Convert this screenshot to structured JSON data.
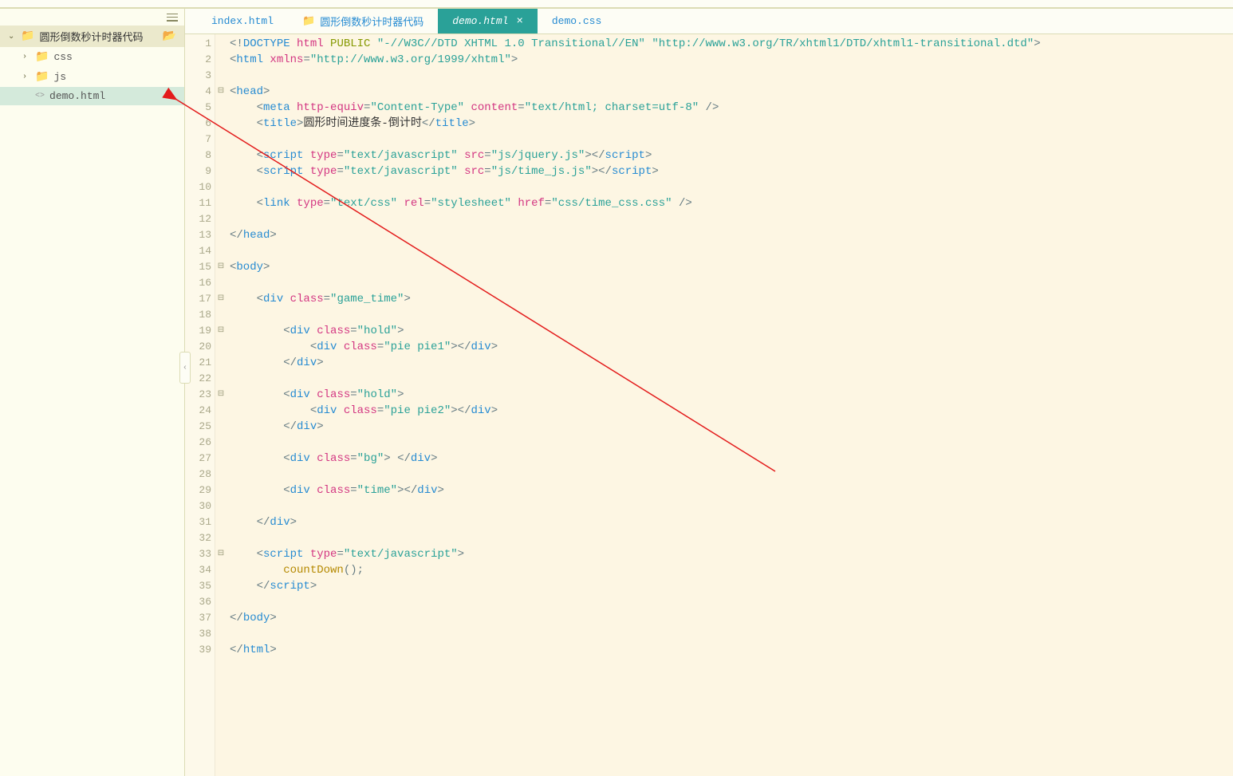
{
  "sidebar": {
    "root": {
      "label": "圆形倒数秒计时器代码"
    },
    "items": [
      {
        "label": "css",
        "type": "folder"
      },
      {
        "label": "js",
        "type": "folder"
      },
      {
        "label": "demo.html",
        "type": "file"
      }
    ]
  },
  "tabs": [
    {
      "label": "index.html",
      "active": false
    },
    {
      "label": "圆形倒数秒计时器代码",
      "active": false,
      "hasFolder": true
    },
    {
      "label": "demo.html",
      "active": true
    },
    {
      "label": "demo.css",
      "active": false
    }
  ],
  "code": {
    "lines": [
      {
        "n": 1,
        "fold": "",
        "segments": [
          {
            "c": "tok-punct",
            "t": "<!"
          },
          {
            "c": "tok-tag",
            "t": "DOCTYPE "
          },
          {
            "c": "tok-attr",
            "t": "html "
          },
          {
            "c": "tok-keyword",
            "t": "PUBLIC "
          },
          {
            "c": "tok-string",
            "t": "\"-//W3C//DTD XHTML 1.0 Transitional//EN\" \"http://www.w3.org/TR/xhtml1/DTD/xhtml1-transitional.dtd\""
          },
          {
            "c": "tok-punct",
            "t": ">"
          }
        ]
      },
      {
        "n": 2,
        "fold": "",
        "segments": [
          {
            "c": "tok-punct",
            "t": "<"
          },
          {
            "c": "tok-tag",
            "t": "html "
          },
          {
            "c": "tok-attr",
            "t": "xmlns"
          },
          {
            "c": "tok-punct",
            "t": "="
          },
          {
            "c": "tok-string",
            "t": "\"http://www.w3.org/1999/xhtml\""
          },
          {
            "c": "tok-punct",
            "t": ">"
          }
        ]
      },
      {
        "n": 3,
        "fold": "",
        "segments": []
      },
      {
        "n": 4,
        "fold": "⊟",
        "segments": [
          {
            "c": "tok-punct",
            "t": "<"
          },
          {
            "c": "tok-tag",
            "t": "head"
          },
          {
            "c": "tok-punct",
            "t": ">"
          }
        ]
      },
      {
        "n": 5,
        "fold": "",
        "indent": 1,
        "segments": [
          {
            "c": "tok-punct",
            "t": "    <"
          },
          {
            "c": "tok-tag",
            "t": "meta "
          },
          {
            "c": "tok-attr",
            "t": "http-equiv"
          },
          {
            "c": "tok-punct",
            "t": "="
          },
          {
            "c": "tok-string",
            "t": "\"Content-Type\" "
          },
          {
            "c": "tok-attr",
            "t": "content"
          },
          {
            "c": "tok-punct",
            "t": "="
          },
          {
            "c": "tok-string",
            "t": "\"text/html; charset=utf-8\" "
          },
          {
            "c": "tok-punct",
            "t": "/>"
          }
        ]
      },
      {
        "n": 6,
        "fold": "",
        "indent": 1,
        "segments": [
          {
            "c": "tok-punct",
            "t": "    <"
          },
          {
            "c": "tok-tag",
            "t": "title"
          },
          {
            "c": "tok-punct",
            "t": ">"
          },
          {
            "c": "tok-text",
            "t": "圆形时间进度条-倒计时"
          },
          {
            "c": "tok-punct",
            "t": "</"
          },
          {
            "c": "tok-tag",
            "t": "title"
          },
          {
            "c": "tok-punct",
            "t": ">"
          }
        ]
      },
      {
        "n": 7,
        "fold": "",
        "indent": 1,
        "segments": []
      },
      {
        "n": 8,
        "fold": "",
        "indent": 1,
        "segments": [
          {
            "c": "tok-punct",
            "t": "    <"
          },
          {
            "c": "tok-tag",
            "t": "script "
          },
          {
            "c": "tok-attr",
            "t": "type"
          },
          {
            "c": "tok-punct",
            "t": "="
          },
          {
            "c": "tok-string",
            "t": "\"text/javascript\" "
          },
          {
            "c": "tok-attr",
            "t": "src"
          },
          {
            "c": "tok-punct",
            "t": "="
          },
          {
            "c": "tok-string",
            "t": "\"js/jquery.js\""
          },
          {
            "c": "tok-punct",
            "t": "></"
          },
          {
            "c": "tok-tag",
            "t": "script"
          },
          {
            "c": "tok-punct",
            "t": ">"
          }
        ]
      },
      {
        "n": 9,
        "fold": "",
        "indent": 1,
        "segments": [
          {
            "c": "tok-punct",
            "t": "    <"
          },
          {
            "c": "tok-tag",
            "t": "script "
          },
          {
            "c": "tok-attr",
            "t": "type"
          },
          {
            "c": "tok-punct",
            "t": "="
          },
          {
            "c": "tok-string",
            "t": "\"text/javascript\" "
          },
          {
            "c": "tok-attr",
            "t": "src"
          },
          {
            "c": "tok-punct",
            "t": "="
          },
          {
            "c": "tok-string",
            "t": "\"js/time_js.js\""
          },
          {
            "c": "tok-punct",
            "t": "></"
          },
          {
            "c": "tok-tag",
            "t": "script"
          },
          {
            "c": "tok-punct",
            "t": ">"
          }
        ]
      },
      {
        "n": 10,
        "fold": "",
        "indent": 1,
        "segments": []
      },
      {
        "n": 11,
        "fold": "",
        "indent": 1,
        "segments": [
          {
            "c": "tok-punct",
            "t": "    <"
          },
          {
            "c": "tok-tag",
            "t": "link "
          },
          {
            "c": "tok-attr",
            "t": "type"
          },
          {
            "c": "tok-punct",
            "t": "="
          },
          {
            "c": "tok-string",
            "t": "\"text/css\" "
          },
          {
            "c": "tok-attr",
            "t": "rel"
          },
          {
            "c": "tok-punct",
            "t": "="
          },
          {
            "c": "tok-string",
            "t": "\"stylesheet\" "
          },
          {
            "c": "tok-attr",
            "t": "href"
          },
          {
            "c": "tok-punct",
            "t": "="
          },
          {
            "c": "tok-string",
            "t": "\"css/time_css.css\" "
          },
          {
            "c": "tok-punct",
            "t": "/>"
          }
        ]
      },
      {
        "n": 12,
        "fold": "",
        "indent": 1,
        "segments": []
      },
      {
        "n": 13,
        "fold": "",
        "segments": [
          {
            "c": "tok-punct",
            "t": "</"
          },
          {
            "c": "tok-tag",
            "t": "head"
          },
          {
            "c": "tok-punct",
            "t": ">"
          }
        ]
      },
      {
        "n": 14,
        "fold": "",
        "segments": []
      },
      {
        "n": 15,
        "fold": "⊟",
        "segments": [
          {
            "c": "tok-punct",
            "t": "<"
          },
          {
            "c": "tok-tag",
            "t": "body"
          },
          {
            "c": "tok-punct",
            "t": ">"
          }
        ]
      },
      {
        "n": 16,
        "fold": "",
        "indent": 1,
        "segments": []
      },
      {
        "n": 17,
        "fold": "⊟",
        "indent": 1,
        "segments": [
          {
            "c": "tok-punct",
            "t": "    <"
          },
          {
            "c": "tok-tag",
            "t": "div "
          },
          {
            "c": "tok-attr",
            "t": "class"
          },
          {
            "c": "tok-punct",
            "t": "="
          },
          {
            "c": "tok-string",
            "t": "\"game_time\""
          },
          {
            "c": "tok-punct",
            "t": ">"
          }
        ]
      },
      {
        "n": 18,
        "fold": "",
        "indent": 2,
        "segments": []
      },
      {
        "n": 19,
        "fold": "⊟",
        "indent": 2,
        "segments": [
          {
            "c": "tok-punct",
            "t": "        <"
          },
          {
            "c": "tok-tag",
            "t": "div "
          },
          {
            "c": "tok-attr",
            "t": "class"
          },
          {
            "c": "tok-punct",
            "t": "="
          },
          {
            "c": "tok-string",
            "t": "\"hold\""
          },
          {
            "c": "tok-punct",
            "t": ">"
          }
        ]
      },
      {
        "n": 20,
        "fold": "",
        "indent": 3,
        "segments": [
          {
            "c": "tok-punct",
            "t": "            <"
          },
          {
            "c": "tok-tag",
            "t": "div "
          },
          {
            "c": "tok-attr",
            "t": "class"
          },
          {
            "c": "tok-punct",
            "t": "="
          },
          {
            "c": "tok-string",
            "t": "\"pie pie1\""
          },
          {
            "c": "tok-punct",
            "t": "></"
          },
          {
            "c": "tok-tag",
            "t": "div"
          },
          {
            "c": "tok-punct",
            "t": ">"
          }
        ]
      },
      {
        "n": 21,
        "fold": "",
        "indent": 2,
        "segments": [
          {
            "c": "tok-punct",
            "t": "        </"
          },
          {
            "c": "tok-tag",
            "t": "div"
          },
          {
            "c": "tok-punct",
            "t": ">"
          }
        ]
      },
      {
        "n": 22,
        "fold": "",
        "indent": 2,
        "segments": []
      },
      {
        "n": 23,
        "fold": "⊟",
        "indent": 2,
        "segments": [
          {
            "c": "tok-punct",
            "t": "        <"
          },
          {
            "c": "tok-tag",
            "t": "div "
          },
          {
            "c": "tok-attr",
            "t": "class"
          },
          {
            "c": "tok-punct",
            "t": "="
          },
          {
            "c": "tok-string",
            "t": "\"hold\""
          },
          {
            "c": "tok-punct",
            "t": ">"
          }
        ]
      },
      {
        "n": 24,
        "fold": "",
        "indent": 3,
        "segments": [
          {
            "c": "tok-punct",
            "t": "            <"
          },
          {
            "c": "tok-tag",
            "t": "div "
          },
          {
            "c": "tok-attr",
            "t": "class"
          },
          {
            "c": "tok-punct",
            "t": "="
          },
          {
            "c": "tok-string",
            "t": "\"pie pie2\""
          },
          {
            "c": "tok-punct",
            "t": "></"
          },
          {
            "c": "tok-tag",
            "t": "div"
          },
          {
            "c": "tok-punct",
            "t": ">"
          }
        ]
      },
      {
        "n": 25,
        "fold": "",
        "indent": 2,
        "segments": [
          {
            "c": "tok-punct",
            "t": "        </"
          },
          {
            "c": "tok-tag",
            "t": "div"
          },
          {
            "c": "tok-punct",
            "t": ">"
          }
        ]
      },
      {
        "n": 26,
        "fold": "",
        "indent": 2,
        "segments": []
      },
      {
        "n": 27,
        "fold": "",
        "indent": 2,
        "segments": [
          {
            "c": "tok-punct",
            "t": "        <"
          },
          {
            "c": "tok-tag",
            "t": "div "
          },
          {
            "c": "tok-attr",
            "t": "class"
          },
          {
            "c": "tok-punct",
            "t": "="
          },
          {
            "c": "tok-string",
            "t": "\"bg\""
          },
          {
            "c": "tok-punct",
            "t": "> </"
          },
          {
            "c": "tok-tag",
            "t": "div"
          },
          {
            "c": "tok-punct",
            "t": ">"
          }
        ]
      },
      {
        "n": 28,
        "fold": "",
        "indent": 2,
        "segments": []
      },
      {
        "n": 29,
        "fold": "",
        "indent": 2,
        "segments": [
          {
            "c": "tok-punct",
            "t": "        <"
          },
          {
            "c": "tok-tag",
            "t": "div "
          },
          {
            "c": "tok-attr",
            "t": "class"
          },
          {
            "c": "tok-punct",
            "t": "="
          },
          {
            "c": "tok-string",
            "t": "\"time\""
          },
          {
            "c": "tok-punct",
            "t": "></"
          },
          {
            "c": "tok-tag",
            "t": "div"
          },
          {
            "c": "tok-punct",
            "t": ">"
          }
        ]
      },
      {
        "n": 30,
        "fold": "",
        "indent": 2,
        "segments": []
      },
      {
        "n": 31,
        "fold": "",
        "indent": 1,
        "segments": [
          {
            "c": "tok-punct",
            "t": "    </"
          },
          {
            "c": "tok-tag",
            "t": "div"
          },
          {
            "c": "tok-punct",
            "t": ">"
          }
        ]
      },
      {
        "n": 32,
        "fold": "",
        "indent": 1,
        "segments": []
      },
      {
        "n": 33,
        "fold": "⊟",
        "indent": 1,
        "segments": [
          {
            "c": "tok-punct",
            "t": "    <"
          },
          {
            "c": "tok-tag",
            "t": "script "
          },
          {
            "c": "tok-attr",
            "t": "type"
          },
          {
            "c": "tok-punct",
            "t": "="
          },
          {
            "c": "tok-string",
            "t": "\"text/javascript\""
          },
          {
            "c": "tok-punct",
            "t": ">"
          }
        ]
      },
      {
        "n": 34,
        "fold": "",
        "indent": 2,
        "segments": [
          {
            "c": "tok-text",
            "t": "        "
          },
          {
            "c": "tok-func",
            "t": "countDown"
          },
          {
            "c": "tok-punct",
            "t": "();"
          }
        ]
      },
      {
        "n": 35,
        "fold": "",
        "indent": 1,
        "segments": [
          {
            "c": "tok-punct",
            "t": "    </"
          },
          {
            "c": "tok-tag",
            "t": "script"
          },
          {
            "c": "tok-punct",
            "t": ">"
          }
        ]
      },
      {
        "n": 36,
        "fold": "",
        "indent": 1,
        "segments": []
      },
      {
        "n": 37,
        "fold": "",
        "segments": [
          {
            "c": "tok-punct",
            "t": "</"
          },
          {
            "c": "tok-tag",
            "t": "body"
          },
          {
            "c": "tok-punct",
            "t": ">"
          }
        ]
      },
      {
        "n": 38,
        "fold": "",
        "segments": []
      },
      {
        "n": 39,
        "fold": "",
        "segments": [
          {
            "c": "tok-punct",
            "t": "</"
          },
          {
            "c": "tok-tag",
            "t": "html"
          },
          {
            "c": "tok-punct",
            "t": ">"
          }
        ]
      }
    ]
  }
}
